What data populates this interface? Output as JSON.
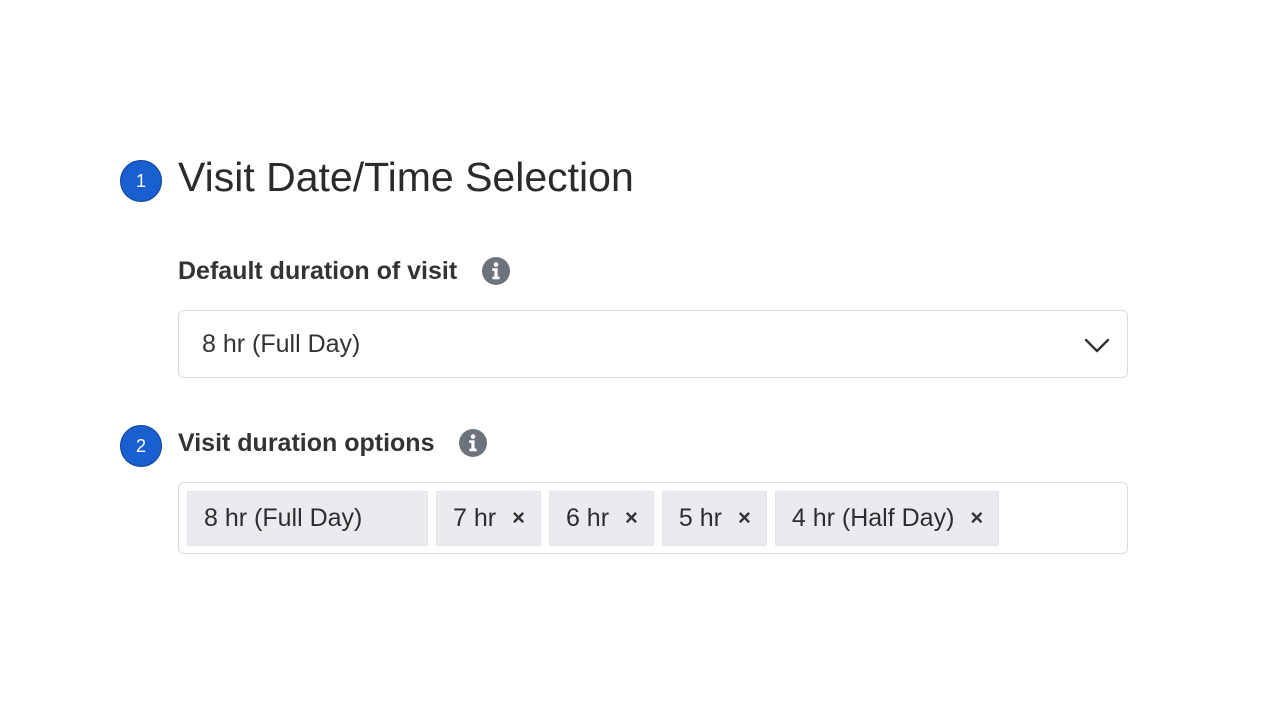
{
  "steps": [
    {
      "number": "1"
    },
    {
      "number": "2"
    }
  ],
  "section": {
    "title": "Visit Date/Time Selection"
  },
  "default_duration": {
    "label": "Default duration of visit",
    "selected": "8 hr (Full Day)",
    "icon": "info-icon",
    "dropdown_icon": "chevron-down-icon"
  },
  "duration_options": {
    "label": "Visit duration options",
    "icon": "info-icon",
    "tags": [
      {
        "label": "8 hr (Full Day)",
        "removable": false
      },
      {
        "label": "7 hr",
        "removable": true,
        "remove_glyph": "×"
      },
      {
        "label": "6 hr",
        "removable": true,
        "remove_glyph": "×"
      },
      {
        "label": "5 hr",
        "removable": true,
        "remove_glyph": "×"
      },
      {
        "label": "4 hr (Half Day)",
        "removable": true,
        "remove_glyph": "×"
      }
    ]
  },
  "colors": {
    "badge": "#1a5fd0",
    "tag_background": "#e9ebee",
    "border": "#d9dcdf",
    "info_icon": "#6d737a"
  }
}
